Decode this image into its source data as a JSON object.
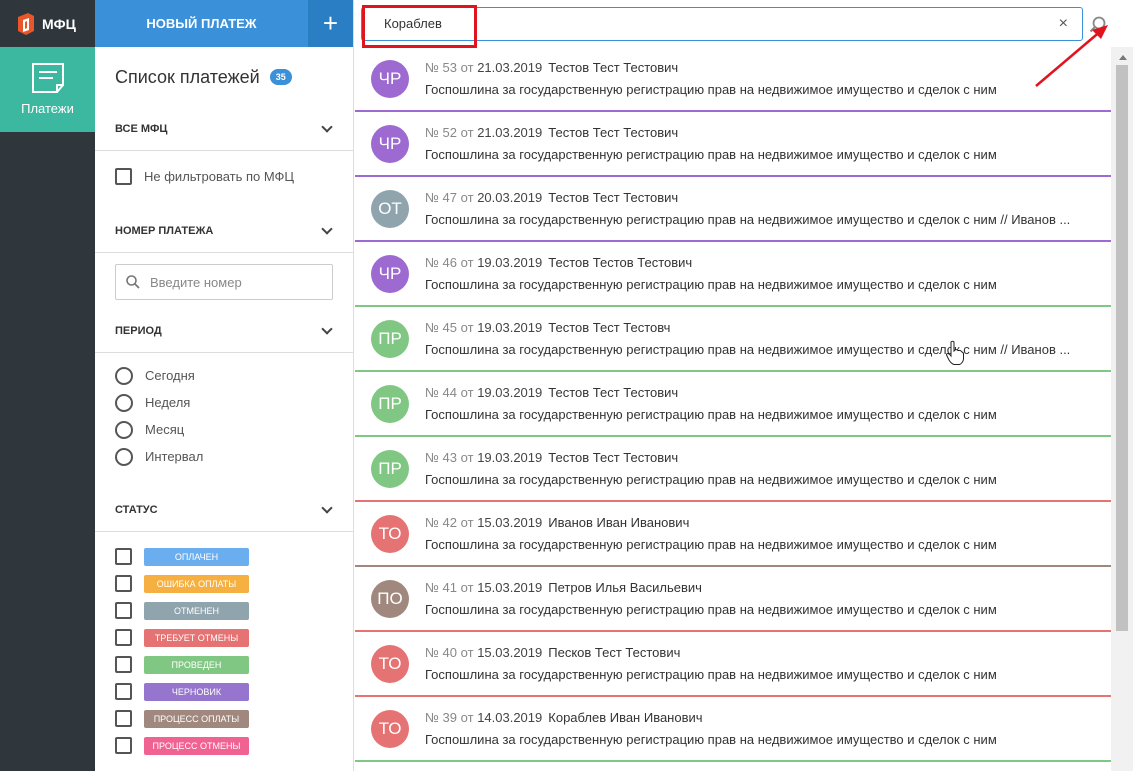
{
  "app": {
    "logo_text": "МФЦ",
    "nav_payments": "Платежи"
  },
  "panel": {
    "new_payment": "НОВЫЙ ПЛАТЕЖ",
    "plus": "+",
    "title": "Список платежей",
    "count": "35",
    "sections": {
      "mfc": "ВСЕ МФЦ",
      "number": "НОМЕР ПЛАТЕЖА",
      "period": "ПЕРИОД",
      "status": "СТАТУС"
    },
    "no_filter": "Не фильтровать по МФЦ",
    "number_placeholder": "Введите номер",
    "periods": [
      "Сегодня",
      "Неделя",
      "Месяц",
      "Интервал"
    ],
    "statuses": [
      {
        "label": "ОПЛАЧЕН",
        "color": "#6aaef0"
      },
      {
        "label": "ОШИБКА ОПЛАТЫ",
        "color": "#f5b041"
      },
      {
        "label": "ОТМЕНЕН",
        "color": "#90a4ae"
      },
      {
        "label": "ТРЕБУЕТ ОТМЕНЫ",
        "color": "#e57373"
      },
      {
        "label": "ПРОВЕДЕН",
        "color": "#81c784"
      },
      {
        "label": "ЧЕРНОВИК",
        "color": "#9575cd"
      },
      {
        "label": "ПРОЦЕСС ОПЛАТЫ",
        "color": "#a1887f"
      },
      {
        "label": "ПРОЦЕСС ОТМЕНЫ",
        "color": "#f06292"
      }
    ]
  },
  "search": {
    "value": "Кораблев",
    "clear": "×"
  },
  "payments": [
    {
      "initials": "ЧР",
      "color": "#9c6ad1",
      "border": "#9c6ad1",
      "num": "№ 53",
      "from": "от",
      "date": "21.03.2019",
      "name": "Тестов Тест Тестович",
      "desc": "Госпошлина за государственную регистрацию прав на недвижимое имущество и сделок с ним"
    },
    {
      "initials": "ЧР",
      "color": "#9c6ad1",
      "border": "#9c6ad1",
      "num": "№ 52",
      "from": "от",
      "date": "21.03.2019",
      "name": "Тестов Тест Тестович",
      "desc": "Госпошлина за государственную регистрацию прав на недвижимое имущество и сделок с ним"
    },
    {
      "initials": "ОТ",
      "color": "#90a4ae",
      "border": "#9c6ad1",
      "num": "№ 47",
      "from": "от",
      "date": "20.03.2019",
      "name": "Тестов Тест Тестович",
      "desc": "Госпошлина за государственную регистрацию прав на недвижимое имущество и сделок с ним // Иванов ..."
    },
    {
      "initials": "ЧР",
      "color": "#9c6ad1",
      "border": "#81c784",
      "num": "№ 46",
      "from": "от",
      "date": "19.03.2019",
      "name": "Тестов Тестов Тестович",
      "desc": "Госпошлина за государственную регистрацию прав на недвижимое имущество и сделок с ним"
    },
    {
      "initials": "ПР",
      "color": "#81c784",
      "border": "#81c784",
      "num": "№ 45",
      "from": "от",
      "date": "19.03.2019",
      "name": "Тестов Тест Тестовч",
      "desc": "Госпошлина за государственную регистрацию прав на недвижимое имущество и сделок с ним // Иванов ..."
    },
    {
      "initials": "ПР",
      "color": "#81c784",
      "border": "#81c784",
      "num": "№ 44",
      "from": "от",
      "date": "19.03.2019",
      "name": "Тестов Тест Тестович",
      "desc": "Госпошлина за государственную регистрацию прав на недвижимое имущество и сделок с ним"
    },
    {
      "initials": "ПР",
      "color": "#81c784",
      "border": "#e57373",
      "num": "№ 43",
      "from": "от",
      "date": "19.03.2019",
      "name": "Тестов Тест Тестович",
      "desc": "Госпошлина за государственную регистрацию прав на недвижимое имущество и сделок с ним"
    },
    {
      "initials": "ТО",
      "color": "#e57373",
      "border": "#a1887f",
      "num": "№ 42",
      "from": "от",
      "date": "15.03.2019",
      "name": "Иванов Иван Иванович",
      "desc": "Госпошлина за государственную регистрацию прав на недвижимое имущество и сделок с ним"
    },
    {
      "initials": "ПО",
      "color": "#a1887f",
      "border": "#e57373",
      "num": "№ 41",
      "from": "от",
      "date": "15.03.2019",
      "name": "Петров Илья Васильевич",
      "desc": "Госпошлина за государственную регистрацию прав на недвижимое имущество и сделок с ним"
    },
    {
      "initials": "ТО",
      "color": "#e57373",
      "border": "#e57373",
      "num": "№ 40",
      "from": "от",
      "date": "15.03.2019",
      "name": "Песков Тест Тестович",
      "desc": "Госпошлина за государственную регистрацию прав на недвижимое имущество и сделок с ним"
    },
    {
      "initials": "ТО",
      "color": "#e57373",
      "border": "#81c784",
      "num": "№ 39",
      "from": "от",
      "date": "14.03.2019",
      "name": "Кораблев Иван Иванович",
      "desc": "Госпошлина за государственную регистрацию прав на недвижимое имущество и сделок с ним"
    }
  ]
}
